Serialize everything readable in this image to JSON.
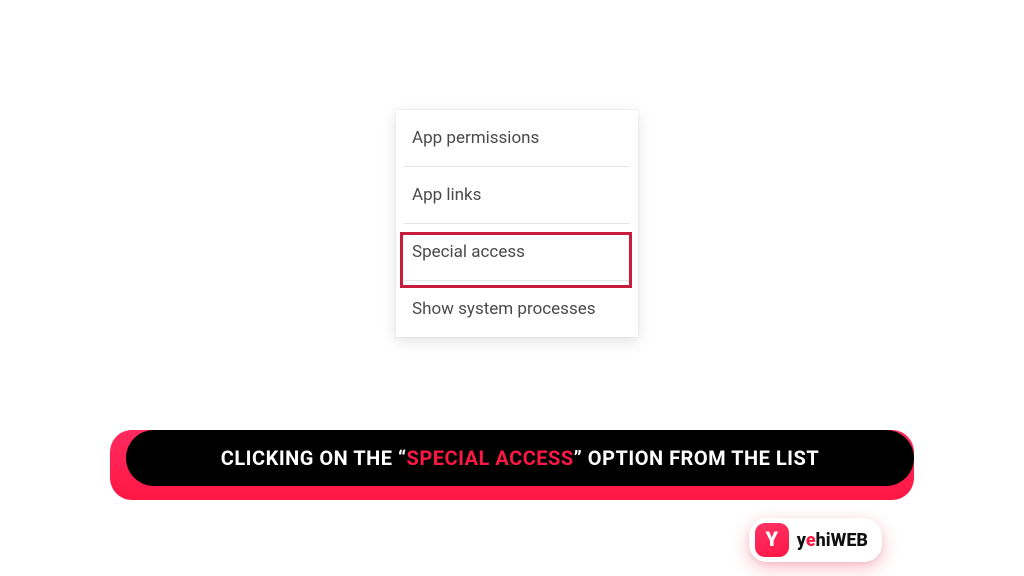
{
  "menu": {
    "items": [
      {
        "label": "App permissions"
      },
      {
        "label": "App links"
      },
      {
        "label": "Special access",
        "highlighted": true
      },
      {
        "label": "Show system processes"
      }
    ]
  },
  "caption": {
    "prefix": "CLICKING ON THE “",
    "highlight": "SPECIAL ACCESS",
    "suffix": "” OPTION FROM THE LIST"
  },
  "logo": {
    "mark": "Y",
    "text_head": "y",
    "text_accent": "e",
    "text_tail": "hiWEB"
  }
}
